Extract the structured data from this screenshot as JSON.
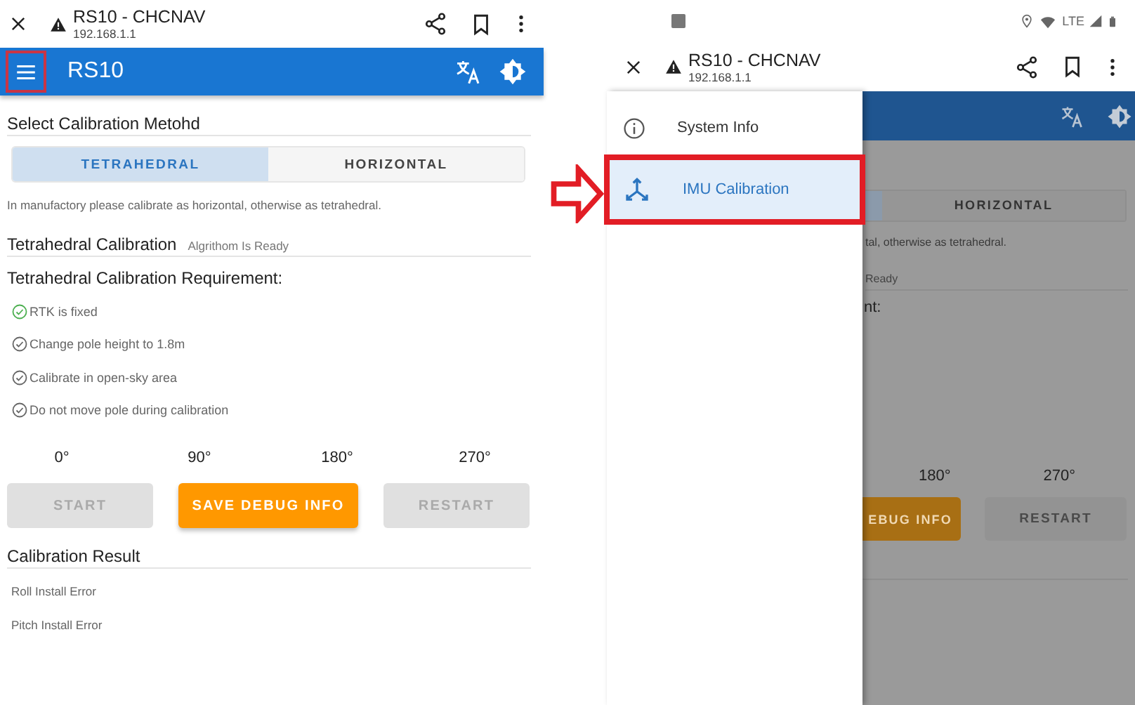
{
  "browser": {
    "title": "RS10 - CHCNAV",
    "url": "192.168.1.1"
  },
  "app_bar": {
    "title": "RS10",
    "menu_highlighted": true
  },
  "method": {
    "heading": "Select Calibration Metohd",
    "options": [
      {
        "label": "TETRAHEDRAL",
        "selected": true
      },
      {
        "label": "HORIZONTAL",
        "selected": false
      }
    ],
    "note": "In manufactory please calibrate as horizontal, otherwise as tetrahedral."
  },
  "calibration": {
    "heading": "Tetrahedral Calibration",
    "status": "Algrithom Is Ready",
    "requirement_title": "Tetrahedral Calibration Requirement:",
    "requirements": [
      {
        "text": "RTK is fixed",
        "met": true
      },
      {
        "text": "Change pole height to 1.8m",
        "met": false
      },
      {
        "text": "Calibrate in open-sky area",
        "met": false
      },
      {
        "text": "Do not move pole during calibration",
        "met": false
      }
    ],
    "angles": [
      "0°",
      "90°",
      "180°",
      "270°"
    ],
    "buttons": [
      {
        "label": "START",
        "disabled": true
      },
      {
        "label": "SAVE DEBUG INFO",
        "disabled": false
      },
      {
        "label": "RESTART",
        "disabled": true
      }
    ]
  },
  "result": {
    "heading": "Calibration Result",
    "rows": [
      "Roll Install Error",
      "Pitch Install Error"
    ]
  },
  "second_screen": {
    "status_bar": {
      "network": "LTE"
    },
    "browser": {
      "title": "RS10 - CHCNAV",
      "url": "192.168.1.1"
    },
    "drawer": {
      "items": [
        {
          "label": "System Info",
          "kind": "info",
          "selected": false,
          "highlighted": false
        },
        {
          "label": "IMU Calibration",
          "kind": "axes",
          "selected": true,
          "highlighted": true
        }
      ]
    },
    "dimmed_page": {
      "option": "HORIZONTAL",
      "note": "tal, otherwise as tetrahedral.",
      "status": "Ready",
      "requirement_title": "nt:",
      "angles": [
        "180°",
        "270°"
      ],
      "buttons": [
        {
          "label": "EBUG INFO",
          "disabled": false
        },
        {
          "label": "RESTART",
          "disabled": true
        }
      ]
    }
  }
}
